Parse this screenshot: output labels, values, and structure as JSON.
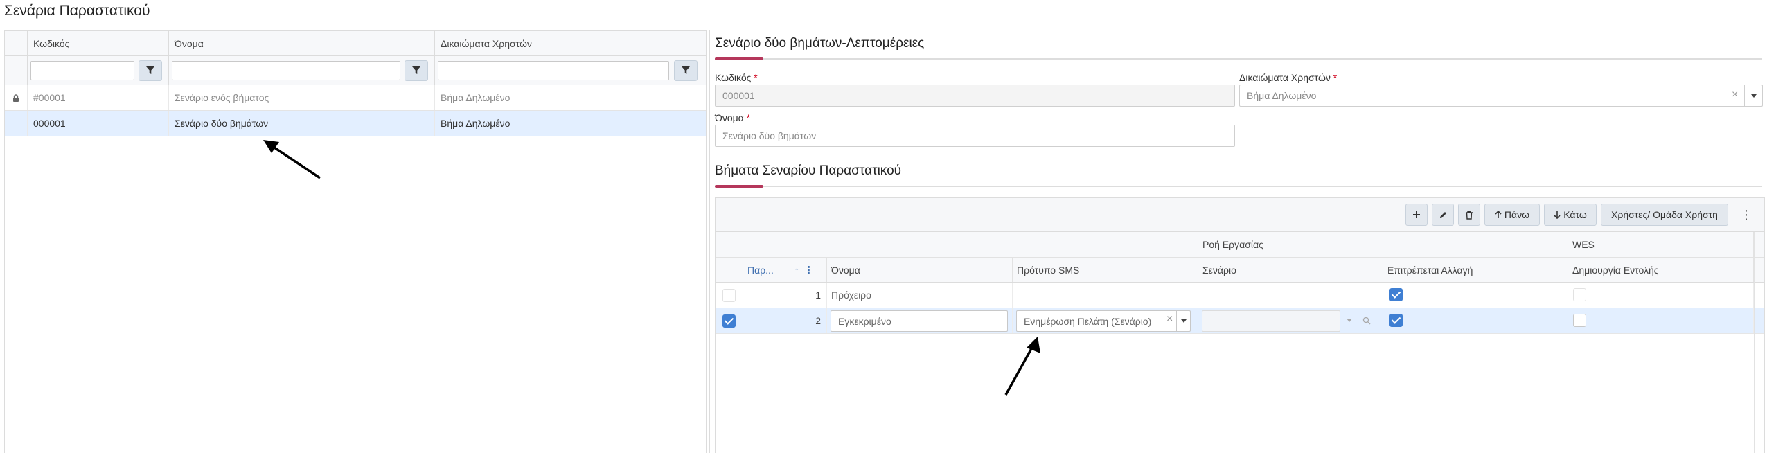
{
  "page": {
    "title": "Σενάρια Παραστατικού"
  },
  "left_grid": {
    "columns": [
      "Κωδικός",
      "Όνομα",
      "Δικαιώματα Χρηστών"
    ],
    "rows": [
      {
        "code": "#00001",
        "name": "Σενάριο ενός βήματος",
        "rights": "Βήμα Δηλωμένο",
        "locked": true,
        "selected": false
      },
      {
        "code": "000001",
        "name": "Σενάριο δύο βημάτων",
        "rights": "Βήμα Δηλωμένο",
        "locked": false,
        "selected": true
      }
    ]
  },
  "details": {
    "title": "Σενάριο δύο βημάτων-Λεπτομέρειες",
    "code_label": "Κωδικός",
    "code_value": "000001",
    "rights_label": "Δικαιώματα Χρηστών",
    "rights_value": "Βήμα Δηλωμένο",
    "name_label": "Όνομα",
    "name_value": "Σενάριο δύο βημάτων",
    "required_mark": "*"
  },
  "steps": {
    "title": "Βήματα Σεναρίου Παραστατικού",
    "toolbar": {
      "up_label": "Πάνω",
      "down_label": "Κάτω",
      "users_label": "Χρήστες/ Ομάδα Χρήστη",
      "more": "⋮"
    },
    "group_headers": {
      "workflow": "Ροή Εργασίας",
      "wes": "WES"
    },
    "columns": {
      "order": "Παρ...",
      "name": "Όνομα",
      "sms": "Πρότυπο SMS",
      "scenario": "Σενάριο",
      "allow_change": "Επιτρέπεται Αλλαγή",
      "create_command": "Δημιουργία Εντολής"
    },
    "rows": [
      {
        "order": "1",
        "name": "Πρόχειρο",
        "sms": "",
        "scenario": "",
        "allow_change": true,
        "create_command": false,
        "selected": false
      },
      {
        "order": "2",
        "name": "Εγκεκριμένο",
        "sms": "Ενημέρωση Πελάτη (Σενάριο)",
        "scenario": "",
        "allow_change": true,
        "create_command": false,
        "selected": true
      }
    ]
  }
}
